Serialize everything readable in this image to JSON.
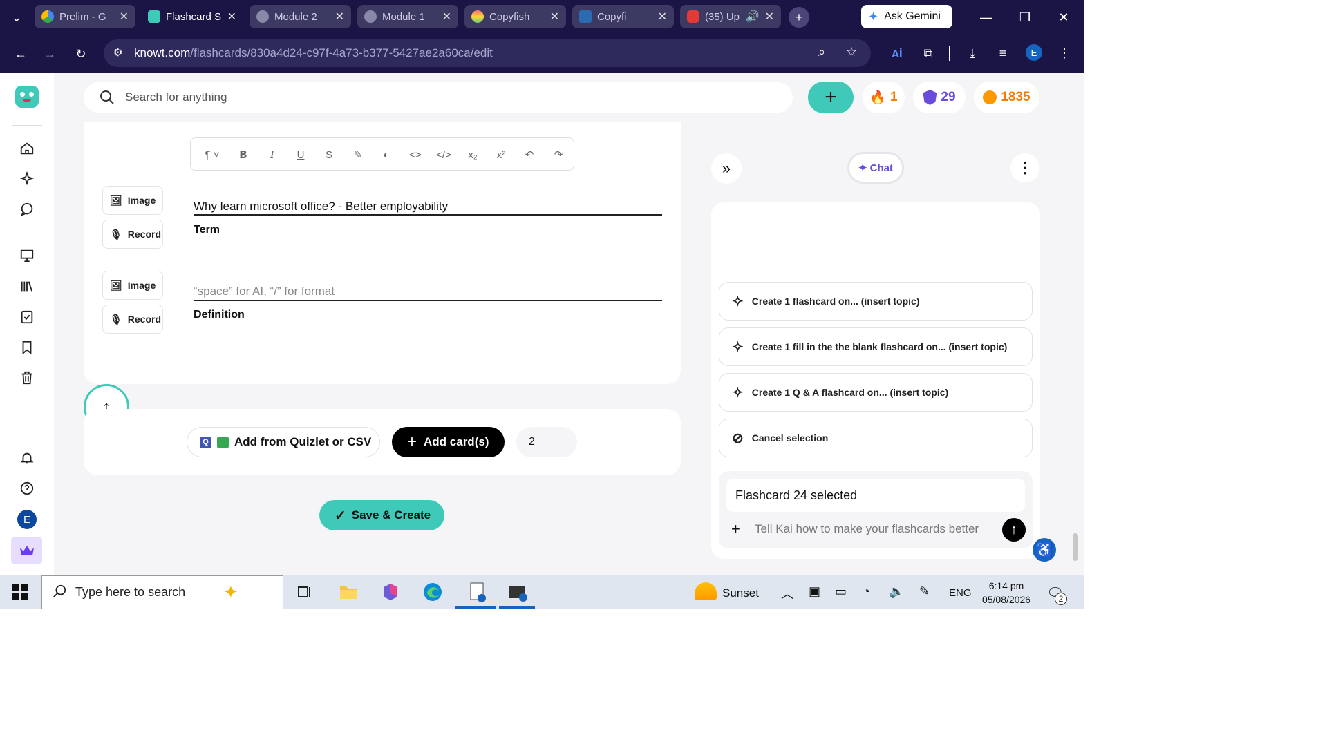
{
  "browser": {
    "tabs": [
      {
        "label": "Prelim - G",
        "color": "#4285f4"
      },
      {
        "label": "Flashcard S",
        "color": "#3ec9b8"
      },
      {
        "label": "Module 2",
        "color": "#777"
      },
      {
        "label": "Module 1",
        "color": "#777"
      },
      {
        "label": "Copyfish",
        "color": "#ff6b6b"
      },
      {
        "label": "Copyfi",
        "color": "#2b6cb0"
      },
      {
        "label": "(35) Up",
        "color": "#e53935"
      }
    ],
    "ask_gemini": "Ask Gemini",
    "url_domain": "knowt.com",
    "url_path": "/flashcards/830a4d24-c97f-4a73-b377-5427ae2a60ca/edit",
    "profile_initial": "E"
  },
  "topbar": {
    "search_placeholder": "Search for anything",
    "streak": "1",
    "level": "29",
    "coins": "1835"
  },
  "editor": {
    "term_text": "Why learn microsoft office? - Better employability",
    "term_label": "Term",
    "definition_placeholder": "“space” for AI, “/” for format",
    "definition_label": "Definition",
    "image_label": "Image",
    "record_label": "Record"
  },
  "actions": {
    "import_label": "Add from Quizlet or CSV",
    "add_cards_label": "Add card(s)",
    "card_count": "2",
    "save_label": "Save & Create"
  },
  "chat": {
    "tab_label": "Chat",
    "suggestions": [
      "Create 1 flashcard on... (insert topic)",
      "Create 1 fill in the the blank flashcard on... (insert topic)",
      "Create 1 Q & A flashcard on... (insert topic)"
    ],
    "cancel_label": "Cancel selection",
    "selected_text": "Flashcard 24 selected",
    "input_placeholder": "Tell Kai how to make your flashcards better"
  },
  "rail": {
    "user_initial": "E"
  },
  "taskbar": {
    "search_placeholder": "Type here to search",
    "weather": "Sunset",
    "language": "ENG",
    "time": "6:14 pm",
    "date": "05/08/2026",
    "notifications": "2"
  }
}
